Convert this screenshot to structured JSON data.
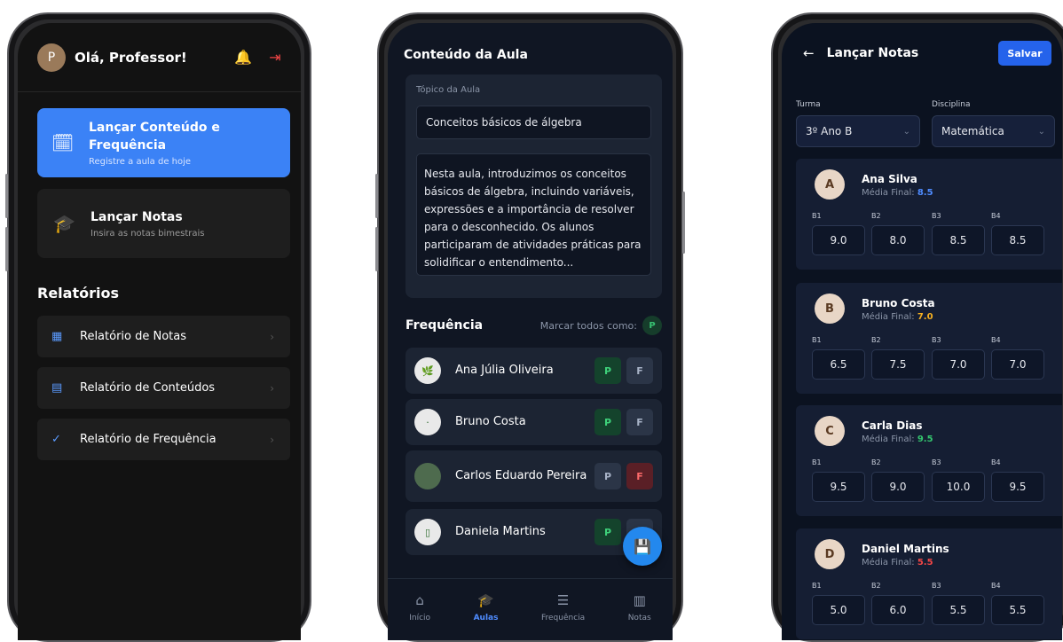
{
  "phone1": {
    "greeting": "Olá, Professor!",
    "avatar_initial": "P",
    "bell_icon": "🔔",
    "logout_icon": "⇥",
    "card_conteudo": {
      "icon": "🗓",
      "title": "Lançar Conteúdo e Frequência",
      "subtitle": "Registre a aula de hoje"
    },
    "card_notas": {
      "icon": "🎓",
      "title": "Lançar Notas",
      "subtitle": "Insira as notas bimestrais"
    },
    "reports_title": "Relatórios",
    "reports": [
      {
        "icon": "▦",
        "label": "Relatório de Notas"
      },
      {
        "icon": "▤",
        "label": "Relatório de Conteúdos"
      },
      {
        "icon": "✓",
        "label": "Relatório de Frequência"
      }
    ],
    "chevron": "›"
  },
  "phone2": {
    "title": "Conteúdo da Aula",
    "topic_label": "Tópico da Aula",
    "topic_value": "Conceitos básicos de álgebra",
    "description": "Nesta aula, introduzimos os conceitos básicos de álgebra, incluindo variáveis, expressões e a importância de resolver para o desconhecido. Os alunos participaram de atividades práticas para solidificar o entendimento...",
    "frequencia_title": "Frequência",
    "mark_all_label": "Marcar todos como:",
    "mark_all_value": "P",
    "students": [
      {
        "name": "Ana Júlia Oliveira",
        "p": "P",
        "f": "F",
        "avatar": "🌿"
      },
      {
        "name": "Bruno Costa",
        "p": "P",
        "f": "F",
        "avatar": "·"
      },
      {
        "name": "Carlos Eduardo Pereira",
        "p": "P",
        "f": "F",
        "avatar": ""
      },
      {
        "name": "Daniela Martins",
        "p": "P",
        "f": "F",
        "avatar": "▯"
      }
    ],
    "fab_icon": "💾",
    "tabs": [
      {
        "icon": "⌂",
        "label": "Início"
      },
      {
        "icon": "🎓",
        "label": "Aulas"
      },
      {
        "icon": "☰",
        "label": "Frequência"
      },
      {
        "icon": "▥",
        "label": "Notas"
      }
    ]
  },
  "phone3": {
    "back_icon": "←",
    "title": "Lançar Notas",
    "save_label": "Salvar",
    "turma_label": "Turma",
    "turma_value": "3º Ano B",
    "disciplina_label": "Disciplina",
    "disciplina_value": "Matemática",
    "caret": "⌄",
    "media_label": "Média Final:",
    "bim_labels": [
      "B1",
      "B2",
      "B3",
      "B4"
    ],
    "students": [
      {
        "name": "Ana Silva",
        "initial": "A",
        "media": "8.5",
        "media_color": "#4f8cff",
        "grades": [
          "9.0",
          "8.0",
          "8.5",
          "8.5"
        ]
      },
      {
        "name": "Bruno Costa",
        "initial": "B",
        "media": "7.0",
        "media_color": "#f5b021",
        "grades": [
          "6.5",
          "7.5",
          "7.0",
          "7.0"
        ]
      },
      {
        "name": "Carla Dias",
        "initial": "C",
        "media": "9.5",
        "media_color": "#34c46e",
        "grades": [
          "9.5",
          "9.0",
          "10.0",
          "9.5"
        ]
      },
      {
        "name": "Daniel Martins",
        "initial": "D",
        "media": "5.5",
        "media_color": "#f04646",
        "grades": [
          "5.0",
          "6.0",
          "5.5",
          "5.5"
        ]
      }
    ]
  }
}
